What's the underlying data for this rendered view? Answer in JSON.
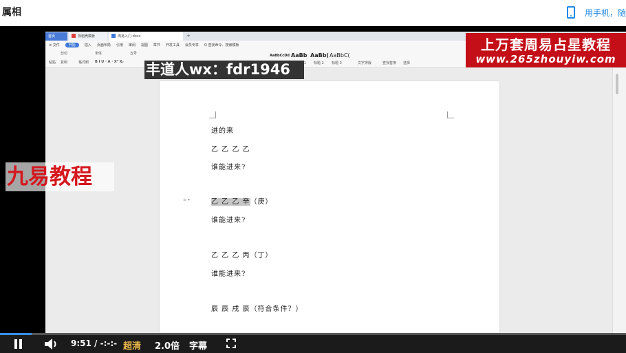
{
  "page": {
    "title": "属相",
    "phone_link": "用手机，随"
  },
  "wps": {
    "tabs": [
      "首页",
      "找稻壳模板",
      "周易入门.docx"
    ],
    "menu": [
      "≡ 文件",
      "开始",
      "插入",
      "页面布局",
      "引用",
      "审阅",
      "视图",
      "章节",
      "开发工具",
      "会员专享",
      "Q 查找命令、搜索模板"
    ],
    "active_menu": "开始",
    "ribbon": {
      "paste": "粘贴",
      "cut": "剪切",
      "copy": "复制",
      "format_painter": "格式刷",
      "font": "宋体",
      "size": "五号",
      "styles": [
        "AaBbCcDd",
        "AaBb",
        "AaBb(",
        "AaBbC("
      ],
      "style_names": [
        "正文",
        "标题 1",
        "标题 2",
        "标题 3"
      ],
      "text_tools": "文字排版",
      "find_replace": "查找替换",
      "select": "选择"
    },
    "doc_lines": [
      {
        "id": "line1",
        "text": "进的来"
      },
      {
        "id": "line2",
        "text": "乙 乙 乙 乙"
      },
      {
        "id": "line3",
        "text": "谁能进来?"
      },
      {
        "id": "line4a",
        "text": "乙 乙 乙 辛"
      },
      {
        "id": "line4b",
        "text": "（庚）"
      },
      {
        "id": "line5",
        "text": "谁能进来?"
      },
      {
        "id": "line6",
        "text": "乙 乙 乙 丙（丁）"
      },
      {
        "id": "line7",
        "text": "谁能进来?"
      },
      {
        "id": "line8",
        "text": "辰 辰 戌 辰（符合条件？）"
      }
    ]
  },
  "watermarks": {
    "right_line1": "上万套周易占星教程",
    "right_line2": "www.265zhouyiw.com",
    "top": "丰道人wx：fdr1946",
    "left": "九易教程"
  },
  "player": {
    "time": "9:51 / -:-:-",
    "quality": "超清",
    "speed": "2.0倍",
    "subtitle": "字幕",
    "progress": 0.05
  },
  "colors": {
    "accent": "#1e88e5",
    "quality": "#e8b64a",
    "watermark_red": "#c40f18",
    "watermark_left": "#d5171e"
  }
}
